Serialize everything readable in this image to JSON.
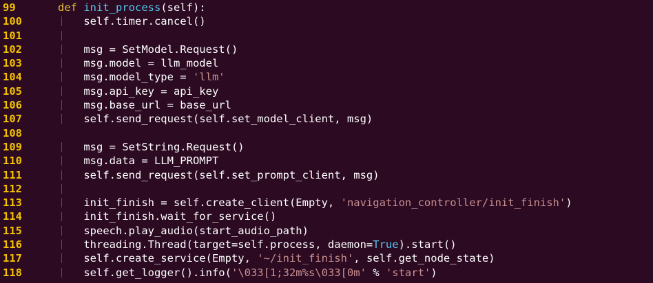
{
  "editor": {
    "colors": {
      "background": "#2b0a22",
      "line_number": "#f3c200",
      "keyword": "#e9c330",
      "function_name": "#57c6ee",
      "string": "#c9908f",
      "builtin_constant": "#57c6ee",
      "text": "#ffffff",
      "indent_guide": "#5e4a59"
    },
    "lines": [
      {
        "num": "99",
        "guide": false,
        "tokens": [
          {
            "t": "kw",
            "v": "def "
          },
          {
            "t": "fn",
            "v": "init_process"
          },
          {
            "t": "plain",
            "v": "(self):"
          }
        ]
      },
      {
        "num": "100",
        "guide": true,
        "tokens": [
          {
            "t": "plain",
            "v": "    self.timer.cancel()"
          }
        ]
      },
      {
        "num": "101",
        "guide": true,
        "tokens": []
      },
      {
        "num": "102",
        "guide": true,
        "tokens": [
          {
            "t": "plain",
            "v": "    msg = SetModel.Request()"
          }
        ]
      },
      {
        "num": "103",
        "guide": true,
        "tokens": [
          {
            "t": "plain",
            "v": "    msg.model = llm_model"
          }
        ]
      },
      {
        "num": "104",
        "guide": true,
        "tokens": [
          {
            "t": "plain",
            "v": "    msg.model_type = "
          },
          {
            "t": "str",
            "v": "'llm'"
          }
        ]
      },
      {
        "num": "105",
        "guide": true,
        "tokens": [
          {
            "t": "plain",
            "v": "    msg.api_key = api_key"
          }
        ]
      },
      {
        "num": "106",
        "guide": true,
        "tokens": [
          {
            "t": "plain",
            "v": "    msg.base_url = base_url"
          }
        ]
      },
      {
        "num": "107",
        "guide": true,
        "tokens": [
          {
            "t": "plain",
            "v": "    self.send_request(self.set_model_client, msg)"
          }
        ]
      },
      {
        "num": "108",
        "guide": false,
        "tokens": []
      },
      {
        "num": "109",
        "guide": true,
        "tokens": [
          {
            "t": "plain",
            "v": "    msg = SetString.Request()"
          }
        ]
      },
      {
        "num": "110",
        "guide": true,
        "tokens": [
          {
            "t": "plain",
            "v": "    msg.data = LLM_PROMPT"
          }
        ]
      },
      {
        "num": "111",
        "guide": true,
        "tokens": [
          {
            "t": "plain",
            "v": "    self.send_request(self.set_prompt_client, msg)"
          }
        ]
      },
      {
        "num": "112",
        "guide": true,
        "tokens": []
      },
      {
        "num": "113",
        "guide": true,
        "tokens": [
          {
            "t": "plain",
            "v": "    init_finish = self.create_client(Empty, "
          },
          {
            "t": "str",
            "v": "'navigation_controller/init_finish'"
          },
          {
            "t": "plain",
            "v": ")"
          }
        ]
      },
      {
        "num": "114",
        "guide": true,
        "tokens": [
          {
            "t": "plain",
            "v": "    init_finish.wait_for_service()"
          }
        ]
      },
      {
        "num": "115",
        "guide": true,
        "tokens": [
          {
            "t": "plain",
            "v": "    speech.play_audio(start_audio_path)"
          }
        ]
      },
      {
        "num": "116",
        "guide": true,
        "tokens": [
          {
            "t": "plain",
            "v": "    threading.Thread(target=self.process, daemon="
          },
          {
            "t": "const",
            "v": "True"
          },
          {
            "t": "plain",
            "v": ").start()"
          }
        ]
      },
      {
        "num": "117",
        "guide": true,
        "tokens": [
          {
            "t": "plain",
            "v": "    self.create_service(Empty, "
          },
          {
            "t": "str",
            "v": "'~/init_finish'"
          },
          {
            "t": "plain",
            "v": ", self.get_node_state)"
          }
        ]
      },
      {
        "num": "118",
        "guide": true,
        "tokens": [
          {
            "t": "plain",
            "v": "    self.get_logger().info("
          },
          {
            "t": "str",
            "v": "'\\033[1;32m%s\\033[0m'"
          },
          {
            "t": "plain",
            "v": " % "
          },
          {
            "t": "str",
            "v": "'start'"
          },
          {
            "t": "plain",
            "v": ")"
          }
        ]
      }
    ]
  }
}
